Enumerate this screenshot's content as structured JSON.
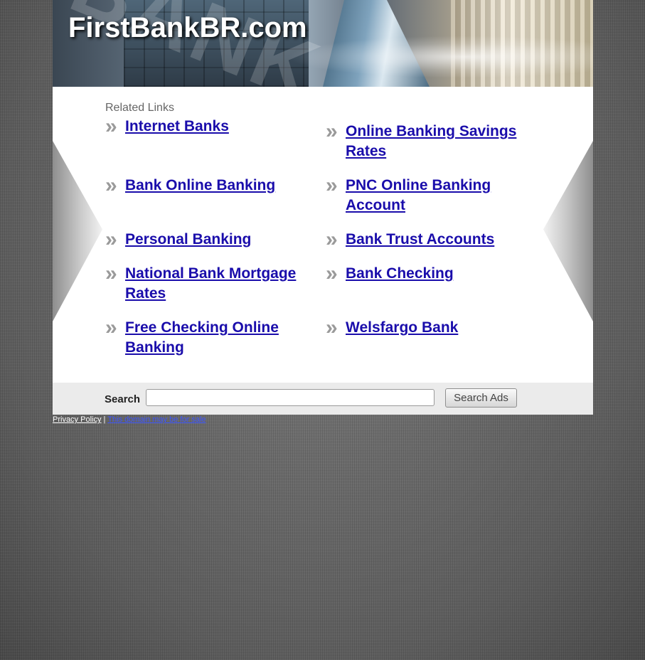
{
  "header": {
    "title": "FirstBankBR.com",
    "ghost_text": "BANK"
  },
  "related": {
    "heading": "Related Links",
    "links": [
      {
        "label": "Internet Banks"
      },
      {
        "label": "Online Banking Savings Rates"
      },
      {
        "label": "Bank Online Banking"
      },
      {
        "label": "PNC Online Banking Account"
      },
      {
        "label": "Personal Banking"
      },
      {
        "label": "Bank Trust Accounts"
      },
      {
        "label": "National Bank Mortgage Rates"
      },
      {
        "label": "Bank Checking"
      },
      {
        "label": "Free Checking Online Banking"
      },
      {
        "label": "Welsfargo Bank"
      }
    ],
    "chevron": "»"
  },
  "search": {
    "label": "Search",
    "value": "",
    "button_label": "Search Ads"
  },
  "footer": {
    "privacy_label": "Privacy Policy",
    "separator": "|",
    "sale_label": "This domain may be for sale"
  },
  "colors": {
    "link": "#1a0dab",
    "chevron": "#9a9a9a",
    "search_bar_bg": "#ebebeb"
  }
}
